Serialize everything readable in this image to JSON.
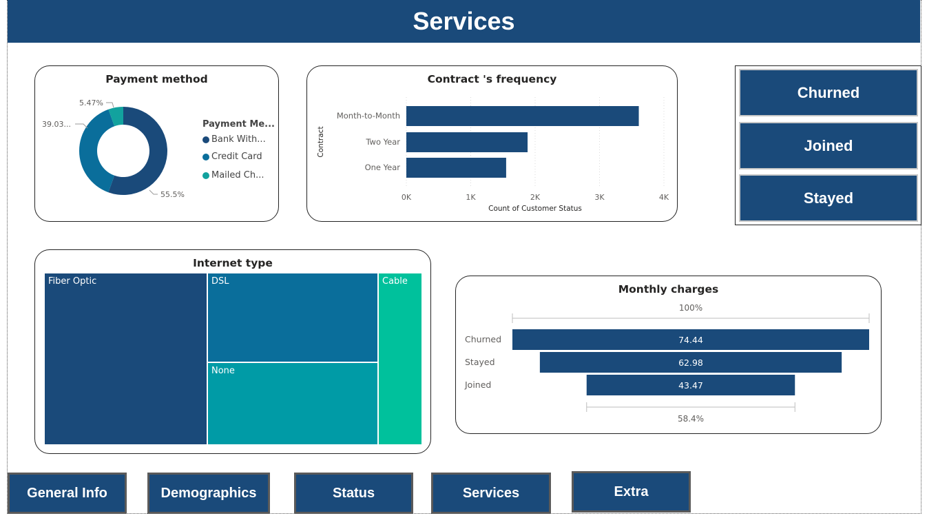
{
  "header": {
    "title": "Services"
  },
  "payment": {
    "title": "Payment method",
    "legend_title": "Payment Me...",
    "items": [
      {
        "label": "Bank With...",
        "color": "#1a4a7a",
        "value": 55.5,
        "data_label": "55.5%"
      },
      {
        "label": "Credit Card",
        "color": "#0a6e9b",
        "value": 39.03,
        "data_label": "39.03..."
      },
      {
        "label": "Mailed Ch...",
        "color": "#12a29e",
        "value": 5.47,
        "data_label": "5.47%"
      }
    ]
  },
  "contract": {
    "title": "Contract 's frequency",
    "ylabel": "Contract",
    "xlabel": "Count of Customer Status",
    "ticks": [
      "0K",
      "1K",
      "2K",
      "3K",
      "4K"
    ]
  },
  "internet": {
    "title": "Internet type",
    "cells": [
      "Fiber Optic",
      "DSL",
      "None",
      "Cable"
    ]
  },
  "monthly": {
    "title": "Monthly charges",
    "top_label": "100%",
    "bottom_label": "58.4%"
  },
  "status_buttons": {
    "churned": "Churned",
    "joined": "Joined",
    "stayed": "Stayed"
  },
  "nav": {
    "general": "General Info",
    "demographics": "Demographics",
    "status": "Status",
    "services": "Services",
    "extra": "Extra"
  },
  "colors": {
    "primary": "#1a4a7a",
    "blue2": "#0a6e9b",
    "teal": "#009ba6",
    "green": "#00c19c"
  },
  "chart_data": [
    {
      "type": "pie",
      "title": "Payment method",
      "categories": [
        "Bank With...",
        "Credit Card",
        "Mailed Ch..."
      ],
      "values": [
        55.5,
        39.03,
        5.47
      ]
    },
    {
      "type": "bar",
      "title": "Contract 's frequency",
      "orientation": "horizontal",
      "categories": [
        "Month-to-Month",
        "Two Year",
        "One Year"
      ],
      "values": [
        3610,
        1883,
        1550
      ],
      "xlabel": "Count of Customer Status",
      "ylabel": "Contract",
      "xlim": [
        0,
        4000
      ]
    },
    {
      "type": "treemap",
      "title": "Internet type",
      "categories": [
        "Fiber Optic",
        "DSL",
        "None",
        "Cable"
      ]
    },
    {
      "type": "funnel",
      "title": "Monthly charges",
      "categories": [
        "Churned",
        "Stayed",
        "Joined"
      ],
      "values": [
        74.44,
        62.98,
        43.47
      ],
      "value_labels": [
        "74.44",
        "62.98",
        "43.47"
      ]
    }
  ]
}
